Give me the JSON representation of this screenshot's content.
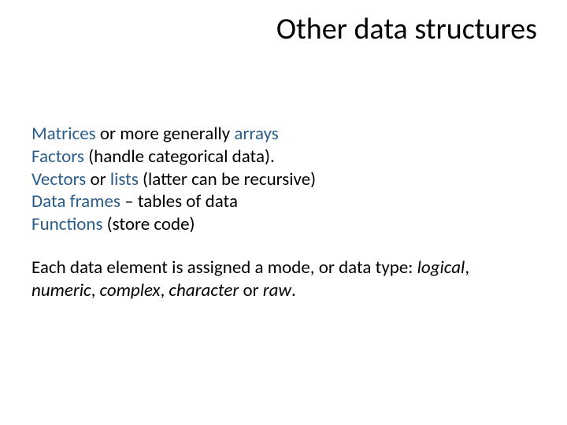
{
  "title": "Other data structures",
  "lines": {
    "l1_term": "Matrices",
    "l1_mid": " or more generally ",
    "l1_term2": "arrays",
    "l2_term": "Factors",
    "l2_rest": " (handle categorical data).",
    "l3_term": "Vectors",
    "l3_mid": " or ",
    "l3_term2": "lists",
    "l3_rest": " (latter can be recursive)",
    "l4_term": "Data frames",
    "l4_rest": " – tables of data",
    "l5_term": "Functions",
    "l5_rest": "  (store code)"
  },
  "para": {
    "p1": "Each data element is assigned a mode, or data type: ",
    "m1": "logical",
    "c1": ", ",
    "m2": "numeric",
    "c2": ", ",
    "m3": "complex",
    "c3": ", ",
    "m4": "character",
    "c4": " or ",
    "m5": "raw",
    "end": "."
  }
}
